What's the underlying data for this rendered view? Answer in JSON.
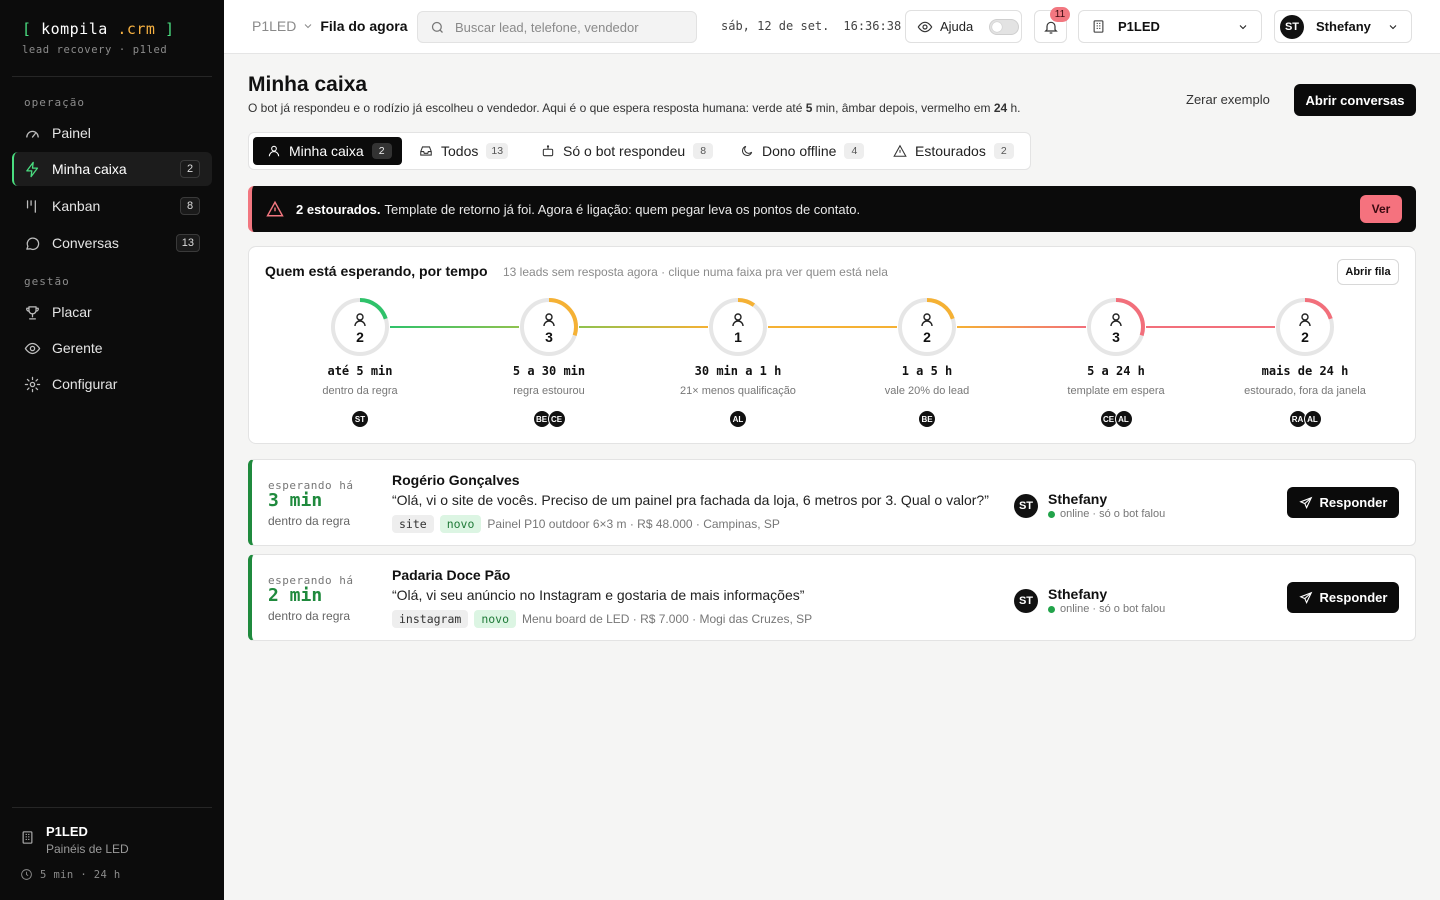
{
  "brand": {
    "open": "[",
    "name": "kompila",
    "suffix": ".crm",
    "close": "]",
    "subtitle": "lead recovery · p1led"
  },
  "sidebar": {
    "sections": [
      {
        "title": "operação"
      },
      {
        "title": "gestão"
      }
    ],
    "items": [
      {
        "label": "Painel",
        "icon": "gauge-icon"
      },
      {
        "label": "Minha caixa",
        "icon": "zap-icon",
        "badge": "2",
        "active": true
      },
      {
        "label": "Kanban",
        "icon": "kanban-icon",
        "badge": "8"
      },
      {
        "label": "Conversas",
        "icon": "chat-icon",
        "badge": "13"
      },
      {
        "label": "Placar",
        "icon": "trophy-icon"
      },
      {
        "label": "Gerente",
        "icon": "eye-icon"
      },
      {
        "label": "Configurar",
        "icon": "gear-icon"
      }
    ],
    "footer": {
      "org_name": "P1LED",
      "org_desc": "Painéis de LED",
      "sla": "5 min · 24 h"
    }
  },
  "topbar": {
    "crumb_org": "P1LED",
    "crumb_current": "Fila do agora",
    "search_placeholder": "Buscar lead, telefone, vendedor",
    "date": "sáb, 12 de set.",
    "time": "16:36:38",
    "help_label": "Ajuda",
    "notifications": "11",
    "org_select": "P1LED",
    "user_initials": "ST",
    "user_name": "Sthefany"
  },
  "main": {
    "title": "Minha caixa",
    "desc_a": "O bot já respondeu e o rodízio já escolheu o vendedor. Aqui é o que espera resposta humana: verde até ",
    "desc_b": "5",
    "desc_c": " min, âmbar depois, vermelho em ",
    "desc_d": "24",
    "desc_e": " h.",
    "reset_label": "Zerar exemplo",
    "open_label": "Abrir conversas"
  },
  "tabs": [
    {
      "label": "Minha caixa",
      "count": "2",
      "icon": "user-icon",
      "active": true
    },
    {
      "label": "Todos",
      "count": "13",
      "icon": "inbox-icon"
    },
    {
      "label": "Só o bot respondeu",
      "count": "8",
      "icon": "bot-icon"
    },
    {
      "label": "Dono offline",
      "count": "4",
      "icon": "moon-icon"
    },
    {
      "label": "Estourados",
      "count": "2",
      "icon": "warning-icon"
    }
  ],
  "alert": {
    "bold": "2 estourados.",
    "text": "Template de retorno já foi. Agora é ligação: quem pegar leva os pontos de contato.",
    "button": "Ver",
    "color": "#f27780"
  },
  "timeline": {
    "title": "Quem está esperando, por tempo",
    "subtitle": "13 leads sem resposta agora · clique numa faixa pra ver quem está nela",
    "button": "Abrir fila",
    "buckets": [
      {
        "count": "2",
        "label": "até 5 min",
        "desc": "dentro da regra",
        "color": "#2fc26a",
        "fill": 0.2,
        "avatars": [
          "ST"
        ]
      },
      {
        "count": "3",
        "label": "5 a 30 min",
        "desc": "regra estourou",
        "color": "#f5b134",
        "fill": 0.3,
        "avatars": [
          "BE",
          "CE"
        ]
      },
      {
        "count": "1",
        "label": "30 min a 1 h",
        "desc": "21× menos qualificação",
        "color": "#f5b134",
        "fill": 0.1,
        "avatars": [
          "AL"
        ]
      },
      {
        "count": "2",
        "label": "1 a 5 h",
        "desc": "vale 20% do lead",
        "color": "#f5b134",
        "fill": 0.2,
        "avatars": [
          "BE"
        ]
      },
      {
        "count": "3",
        "label": "5 a 24 h",
        "desc": "template em espera",
        "color": "#f26f7b",
        "fill": 0.3,
        "avatars": [
          "CE",
          "AL"
        ]
      },
      {
        "count": "2",
        "label": "mais de 24 h",
        "desc": "estourado, fora da janela",
        "color": "#f26f7b",
        "fill": 0.2,
        "avatars": [
          "RA",
          "AL"
        ]
      }
    ]
  },
  "leads": [
    {
      "waiting_label": "esperando há",
      "wait": "3 min",
      "rule": "dentro da regra",
      "name": "Rogério Gonçalves",
      "message": "“Olá, vi o site de vocês. Preciso de um painel pra fachada da loja, 6 metros por 3. Qual o valor?”",
      "source": "site",
      "status": "novo",
      "details": "Painel P10 outdoor 6×3 m · R$ 48.000 · Campinas, SP",
      "owner_initials": "ST",
      "owner": "Sthefany",
      "owner_status": "online · só o bot falou",
      "reply": "Responder"
    },
    {
      "waiting_label": "esperando há",
      "wait": "2 min",
      "rule": "dentro da regra",
      "name": "Padaria Doce Pão",
      "message": "“Olá, vi seu anúncio no Instagram e gostaria de mais informações”",
      "source": "instagram",
      "status": "novo",
      "details": "Menu board de LED · R$ 7.000 · Mogi das Cruzes, SP",
      "owner_initials": "ST",
      "owner": "Sthefany",
      "owner_status": "online · só o bot falou",
      "reply": "Responder"
    }
  ]
}
